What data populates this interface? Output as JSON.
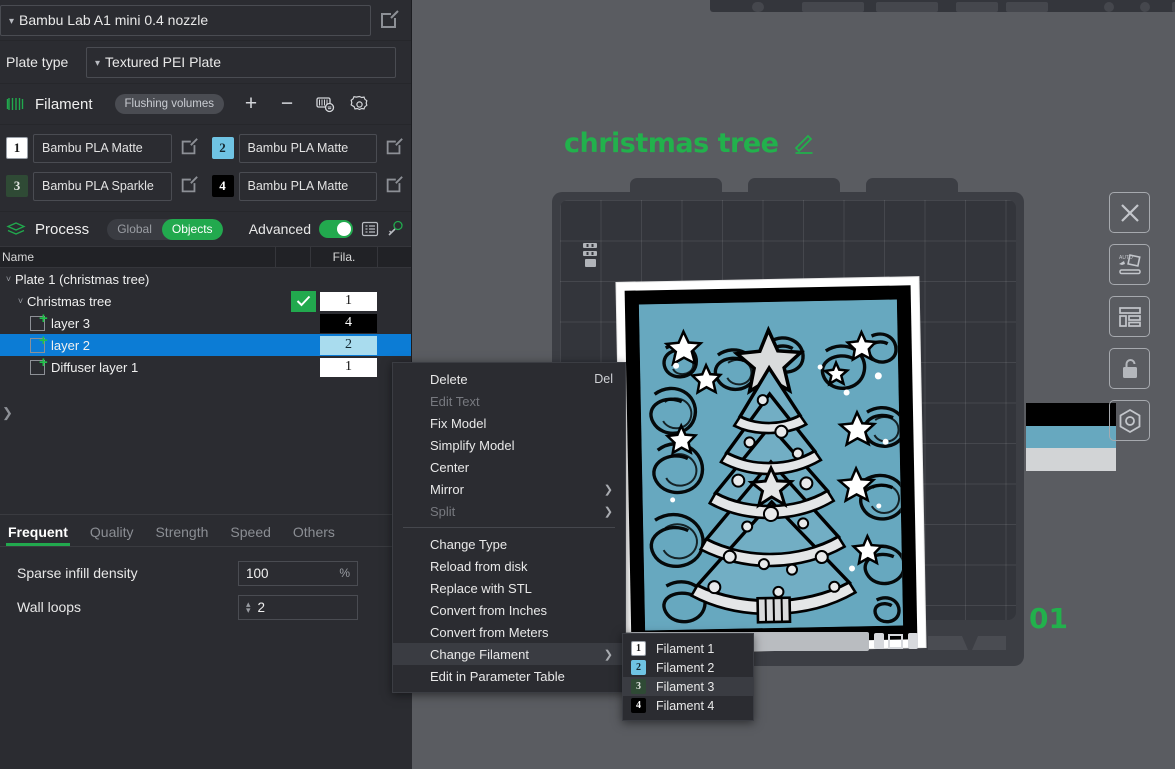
{
  "printer": {
    "name": "Bambu Lab A1 mini 0.4 nozzle",
    "edit_icon": "edit-square-icon",
    "plate_type_label": "Plate type",
    "plate_type_value": "Textured PEI Plate"
  },
  "filament": {
    "title": "Filament",
    "flushing_volumes": "Flushing volumes",
    "add": "+",
    "remove": "−",
    "slots": [
      {
        "index": "1",
        "name": "Bambu PLA Matte",
        "color": "#ffffff",
        "text_color": "#1b1b1b"
      },
      {
        "index": "2",
        "name": "Bambu PLA Matte",
        "color": "#6fc3e3",
        "text_color": "#14262e"
      },
      {
        "index": "3",
        "name": "Bambu PLA Sparkle",
        "color": "#2f4a35",
        "text_color": "#dfe3df"
      },
      {
        "index": "4",
        "name": "Bambu PLA Matte",
        "color": "#000000",
        "text_color": "#ffffff"
      }
    ]
  },
  "process": {
    "title": "Process",
    "scope_global": "Global",
    "scope_objects": "Objects",
    "advanced_label": "Advanced",
    "advanced_on": true
  },
  "object_table": {
    "columns": [
      "Name",
      "",
      "Fila.",
      ""
    ],
    "rows": [
      {
        "label": "Plate 1 (christmas tree)",
        "depth": 0,
        "expander": "˅",
        "fila": "",
        "selected": false,
        "checked": false
      },
      {
        "label": "Christmas tree",
        "depth": 1,
        "expander": "˅",
        "fila": "1",
        "selected": false,
        "checked": true,
        "fila_bg": "#ffffff",
        "fila_fg": "#111111"
      },
      {
        "label": "layer 3",
        "depth": 2,
        "expander": "",
        "fila": "4",
        "selected": false,
        "checked": false,
        "fila_bg": "#000000",
        "fila_fg": "#ffffff"
      },
      {
        "label": "layer 2",
        "depth": 2,
        "expander": "",
        "fila": "2",
        "selected": true,
        "checked": false,
        "fila_bg": "#a9dcee",
        "fila_fg": "#11252d"
      },
      {
        "label": "Diffuser layer 1",
        "depth": 2,
        "expander": "",
        "fila": "1",
        "selected": false,
        "checked": false,
        "fila_bg": "#ffffff",
        "fila_fg": "#111111"
      }
    ]
  },
  "param_tabs": [
    {
      "label": "Frequent",
      "active": true
    },
    {
      "label": "Quality",
      "active": false
    },
    {
      "label": "Strength",
      "active": false
    },
    {
      "label": "Speed",
      "active": false
    },
    {
      "label": "Others",
      "active": false
    }
  ],
  "params": [
    {
      "label": "Sparse infill density",
      "value": "100",
      "unit": "%",
      "spinner": false
    },
    {
      "label": "Wall loops",
      "value": "2",
      "unit": "",
      "spinner": true
    }
  ],
  "viewport": {
    "title": "christmas tree",
    "edit_pencil_icon": "pencil-icon",
    "plate_number": "01",
    "plate_strip_left": "",
    "plate_strip_right": "",
    "right_tools": [
      {
        "name": "delete-plate-icon",
        "glyph": "close-x-icon"
      },
      {
        "name": "auto-arrange-icon",
        "glyph": "auto-arrange-icon"
      },
      {
        "name": "auto-orient-icon",
        "glyph": "layout-icon"
      },
      {
        "name": "lock-plate-icon",
        "glyph": "lock-open-icon"
      },
      {
        "name": "plate-settings-icon",
        "glyph": "hex-gear-icon"
      }
    ],
    "swatch_colors": [
      "#000000",
      "#67a8bf",
      "#d2d4d6"
    ],
    "art_colors": {
      "background": "#67a8bf",
      "ink": "#000000",
      "highlight": "#e2e4e5",
      "border": "#ffffff"
    }
  },
  "context_menu": {
    "items": [
      {
        "label": "Delete",
        "shortcut": "Del",
        "disabled": false,
        "submenu": false,
        "highlight": false
      },
      {
        "label": "Edit Text",
        "shortcut": "",
        "disabled": true,
        "submenu": false,
        "highlight": false
      },
      {
        "label": "Fix Model",
        "shortcut": "",
        "disabled": false,
        "submenu": false,
        "highlight": false
      },
      {
        "label": "Simplify Model",
        "shortcut": "",
        "disabled": false,
        "submenu": false,
        "highlight": false
      },
      {
        "label": "Center",
        "shortcut": "",
        "disabled": false,
        "submenu": false,
        "highlight": false
      },
      {
        "label": "Mirror",
        "shortcut": "",
        "disabled": false,
        "submenu": true,
        "highlight": false
      },
      {
        "label": "Split",
        "shortcut": "",
        "disabled": true,
        "submenu": true,
        "highlight": false
      },
      {
        "separator": true
      },
      {
        "label": "Change Type",
        "shortcut": "",
        "disabled": false,
        "submenu": false,
        "highlight": false
      },
      {
        "label": "Reload from disk",
        "shortcut": "",
        "disabled": false,
        "submenu": false,
        "highlight": false
      },
      {
        "label": "Replace with STL",
        "shortcut": "",
        "disabled": false,
        "submenu": false,
        "highlight": false
      },
      {
        "label": "Convert from Inches",
        "shortcut": "",
        "disabled": false,
        "submenu": false,
        "highlight": false
      },
      {
        "label": "Convert from Meters",
        "shortcut": "",
        "disabled": false,
        "submenu": false,
        "highlight": false
      },
      {
        "label": "Change Filament",
        "shortcut": "",
        "disabled": false,
        "submenu": true,
        "highlight": true
      },
      {
        "label": "Edit in Parameter Table",
        "shortcut": "",
        "disabled": false,
        "submenu": false,
        "highlight": false
      }
    ]
  },
  "filament_submenu": {
    "items": [
      {
        "index": "1",
        "label": "Filament 1",
        "color": "#ffffff",
        "text_color": "#1b1b1b",
        "highlight": false
      },
      {
        "index": "2",
        "label": "Filament 2",
        "color": "#6fc3e3",
        "text_color": "#14262e",
        "highlight": false
      },
      {
        "index": "3",
        "label": "Filament 3",
        "color": "#2f4a35",
        "text_color": "#dfe3df",
        "highlight": true
      },
      {
        "index": "4",
        "label": "Filament 4",
        "color": "#000000",
        "text_color": "#ffffff",
        "highlight": false
      }
    ]
  }
}
